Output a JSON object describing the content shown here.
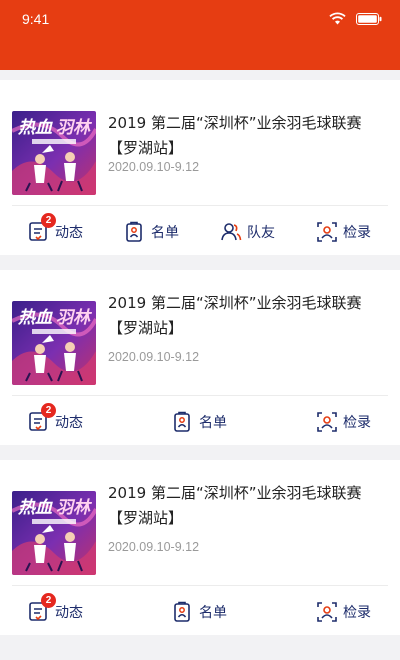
{
  "status_bar": {
    "time": "9:41"
  },
  "accent_color": "#e63d12",
  "brand_color": "#1d2c6b",
  "badge_color": "#e5281f",
  "events": [
    {
      "title": "2019 第二届“深圳杯”业余羽毛球联赛【罗湖站】",
      "date": "2020.09.10-9.12",
      "actions": [
        {
          "label": "动态",
          "icon": "news-icon",
          "badge": "2"
        },
        {
          "label": "名单",
          "icon": "roster-icon"
        },
        {
          "label": "队友",
          "icon": "teammates-icon"
        },
        {
          "label": "检录",
          "icon": "checkin-icon"
        }
      ]
    },
    {
      "title": "2019 第二届“深圳杯”业余羽毛球联赛【罗湖站】",
      "date": "2020.09.10-9.12",
      "actions": [
        {
          "label": "动态",
          "icon": "news-icon",
          "badge": "2"
        },
        {
          "label": "名单",
          "icon": "roster-icon"
        },
        {
          "label": "检录",
          "icon": "checkin-icon"
        }
      ]
    },
    {
      "title": "2019 第二届“深圳杯”业余羽毛球联赛【罗湖站】",
      "date": "2020.09.10-9.12",
      "actions": [
        {
          "label": "动态",
          "icon": "news-icon",
          "badge": "2"
        },
        {
          "label": "名单",
          "icon": "roster-icon"
        },
        {
          "label": "检录",
          "icon": "checkin-icon"
        }
      ]
    }
  ]
}
